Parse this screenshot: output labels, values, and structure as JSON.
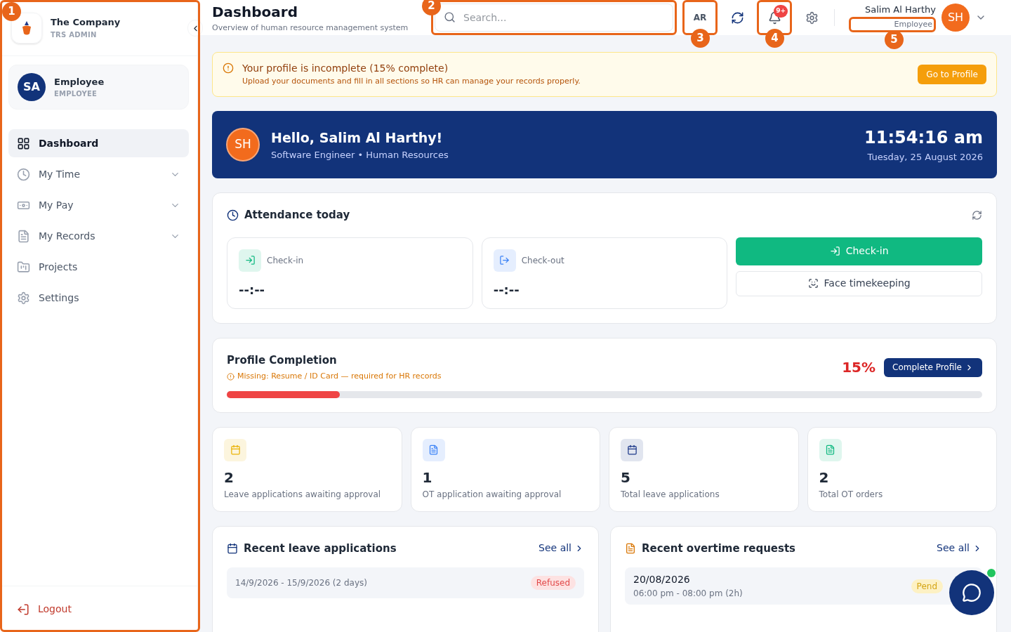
{
  "brand": {
    "name": "The Company",
    "subtitle": "TRS ADMIN"
  },
  "user_card": {
    "initials": "SA",
    "name": "Employee",
    "role": "EMPLOYEE"
  },
  "sidebar": {
    "items": [
      {
        "label": "Dashboard",
        "selected": true,
        "expandable": false
      },
      {
        "label": "My Time",
        "selected": false,
        "expandable": true
      },
      {
        "label": "My Pay",
        "selected": false,
        "expandable": true
      },
      {
        "label": "My Records",
        "selected": false,
        "expandable": true
      },
      {
        "label": "Projects",
        "selected": false,
        "expandable": false
      },
      {
        "label": "Settings",
        "selected": false,
        "expandable": false
      }
    ],
    "logout": "Logout"
  },
  "header": {
    "title": "Dashboard",
    "subtitle": "Overview of human resource management system",
    "search": {
      "placeholder": "Search..."
    },
    "language": "AR",
    "notifications": "9+",
    "user_name": "Salim Al Harthy",
    "user_role": "Employee",
    "user_initials": "SH"
  },
  "alert": {
    "title": "Your profile is incomplete (15% complete)",
    "text": "Upload your documents and fill in all sections so HR can manage your records properly.",
    "button": "Go to Profile"
  },
  "greeting": {
    "initials": "SH",
    "title": "Hello, Salim Al Harthy!",
    "subtitle": "Software Engineer • Human Resources",
    "time": "11:54:16 am",
    "date": "Tuesday, 25 August 2026"
  },
  "attendance": {
    "title": "Attendance today",
    "cards": [
      {
        "label": "Check-in",
        "value": "--:--",
        "color": "#10b981"
      },
      {
        "label": "Check-out",
        "value": "--:--",
        "color": "#3b82f6"
      }
    ],
    "primary_button": "Check-in",
    "secondary_button": "Face timekeeping"
  },
  "profile_completion": {
    "title": "Profile Completion",
    "missing": "Missing: Resume / ID Card — required for HR records",
    "percent": "15%",
    "button": "Complete Profile",
    "level": 0.15
  },
  "stats": [
    {
      "value": "2",
      "label": "Leave applications awaiting approval",
      "color": "#eab308"
    },
    {
      "value": "1",
      "label": "OT application awaiting approval",
      "color": "#3b82f6"
    },
    {
      "value": "5",
      "label": "Total leave applications",
      "color": "#1e3a8a"
    },
    {
      "value": "2",
      "label": "Total OT orders",
      "color": "#10b981"
    }
  ],
  "recent_leave": {
    "title": "Recent leave applications",
    "see_all": "See all",
    "rows": [
      {
        "text": "14/9/2026 - 15/9/2026 (2 days)",
        "status": "Refused",
        "kind": "refused"
      }
    ]
  },
  "recent_overtime": {
    "title": "Recent overtime requests",
    "see_all": "See all",
    "rows": [
      {
        "date": "20/08/2026",
        "time": "06:00 pm - 08:00 pm (2h)",
        "status": "Pend",
        "kind": "pending"
      }
    ]
  },
  "annotations": [
    {
      "label": "1"
    },
    {
      "label": "2"
    },
    {
      "label": "3"
    },
    {
      "label": "4"
    },
    {
      "label": "5"
    }
  ]
}
